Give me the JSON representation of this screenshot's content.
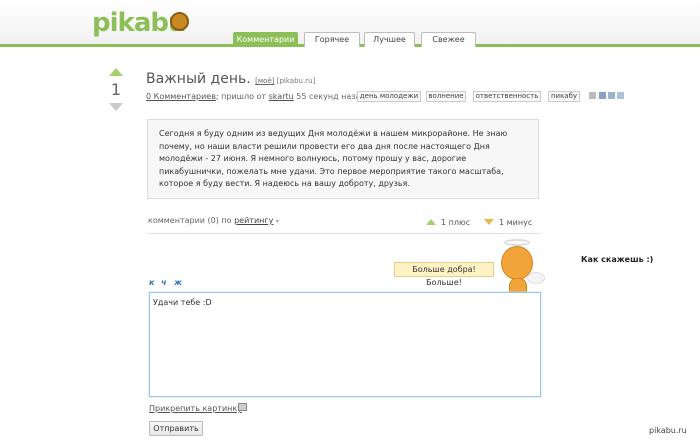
{
  "site": {
    "logo": "pikabu",
    "watermark": "pikabu.ru"
  },
  "tabs": [
    {
      "label": "Комментарии",
      "active": true
    },
    {
      "label": "Горячее",
      "active": false
    },
    {
      "label": "Лучшее",
      "active": false
    },
    {
      "label": "Свежее",
      "active": false
    }
  ],
  "post": {
    "rating": "1",
    "title": "Важный день.",
    "title_link_mine": "[моё]",
    "title_source": "[pikabu.ru]",
    "comments_link": "0 Комментариев",
    "meta_middle": "; пришло от",
    "author": "skartu",
    "time": "55 секунд назад",
    "tags": [
      "день молодежи",
      "волнение",
      "ответственность",
      "пикабу"
    ],
    "body": "Сегодня я буду одним из ведущих Дня молодёжи в нашем микрорайоне. Не знаю почему, но наши власти решили провести его два дня после настоящего Дня молодёжи - 27 июня. Я немного волнуюсь, потому прошу у вас, дорогие пикабушнички, пожелать мне удачи. Это первое мероприятие такого масштаба, которое я буду вести. Я надеюсь на вашу доброту, друзья."
  },
  "comments": {
    "count_label": "комментарии (0) по",
    "sort_label": "рейтингу",
    "plus_label": "1 плюс",
    "minus_label": "1 минус"
  },
  "format_buttons": [
    "к",
    "ч",
    "ж"
  ],
  "mascot": {
    "bubble": "Больше добра! Больше!"
  },
  "side_text": "Как скажешь :)",
  "comment_input": {
    "value": "Удачи тебе :D"
  },
  "attach_label": "Прикрепить картинку",
  "send_label": "Отправить",
  "colors": {
    "accent": "#8cbf57",
    "minus": "#e6b94a",
    "link": "#3a78b5"
  }
}
